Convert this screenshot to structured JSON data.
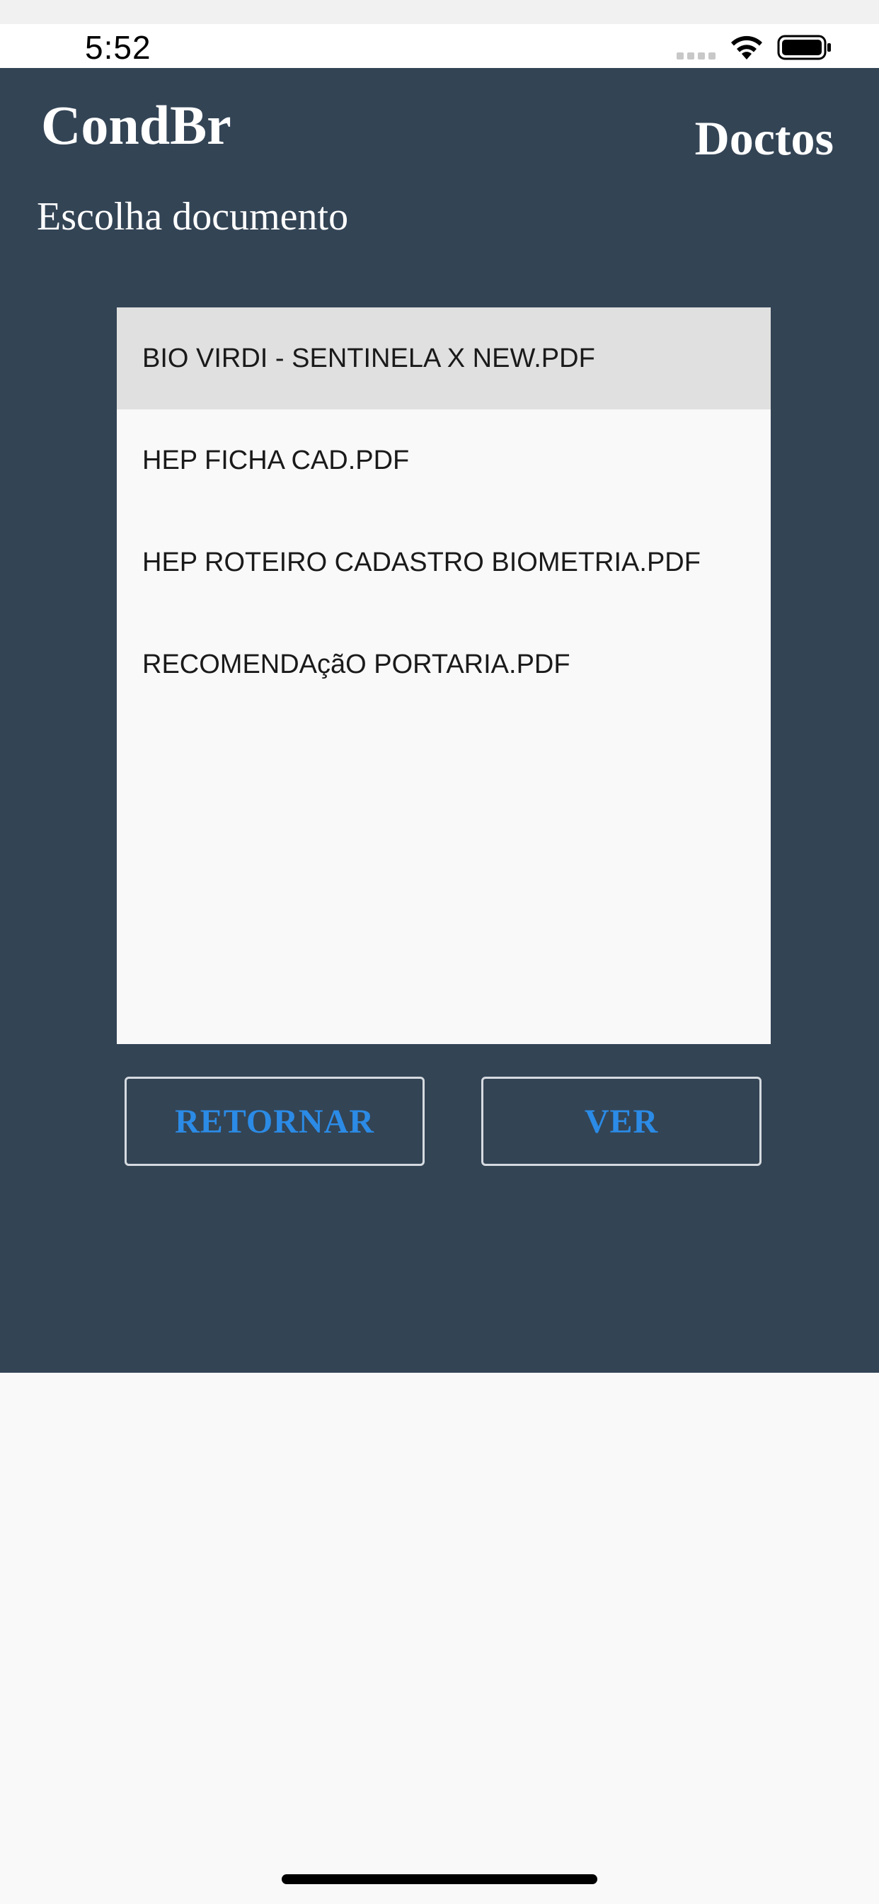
{
  "status_bar": {
    "time": "5:52",
    "icons": [
      "signal-dots-icon",
      "wifi-icon",
      "battery-icon"
    ]
  },
  "header": {
    "app_title": "CondBr",
    "section_title": "Doctos"
  },
  "subtitle": "Escolha documento",
  "documents": [
    {
      "label": "BIO VIRDI - SENTINELA X NEW.PDF",
      "selected": true
    },
    {
      "label": "HEP FICHA CAD.PDF",
      "selected": false
    },
    {
      "label": "HEP ROTEIRO CADASTRO BIOMETRIA.PDF",
      "selected": false
    },
    {
      "label": "RECOMENDAçãO PORTARIA.PDF",
      "selected": false
    }
  ],
  "buttons": {
    "return_label": "RETORNAR",
    "view_label": "VER"
  },
  "colors": {
    "panel_bg": "#334455",
    "accent": "#2b8be6",
    "selected_row": "#e0e0e0",
    "list_bg": "#f9f9f9"
  }
}
